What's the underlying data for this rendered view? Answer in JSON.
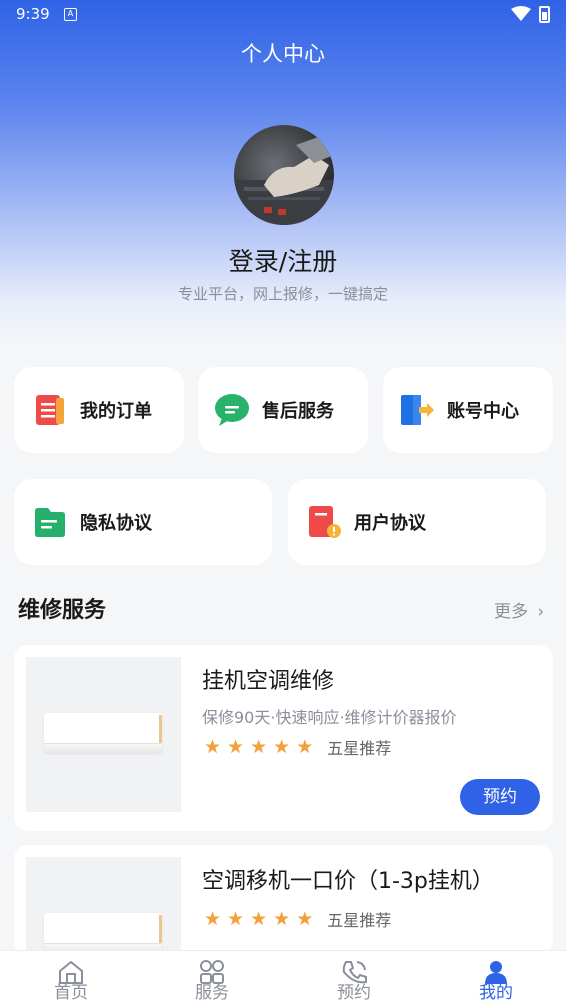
{
  "status_bar": {
    "time": "9:39",
    "notif_glyph": "A"
  },
  "header": {
    "title": "个人中心"
  },
  "profile": {
    "login_label": "登录/注册",
    "slogan": "专业平台，网上报修，一键搞定"
  },
  "quick_actions": [
    {
      "label": "我的订单",
      "icon": "order-list-icon"
    },
    {
      "label": "售后服务",
      "icon": "chat-bubble-icon"
    },
    {
      "label": "账号中心",
      "icon": "account-exit-icon"
    },
    {
      "label": "隐私协议",
      "icon": "privacy-folder-icon"
    },
    {
      "label": "用户协议",
      "icon": "user-agreement-icon"
    }
  ],
  "repair_section": {
    "title": "维修服务",
    "more_label": "更多"
  },
  "services": [
    {
      "name": "挂机空调维修",
      "desc": "保修90天·快速响应·维修计价器报价",
      "stars": 5,
      "rating_label": "五星推荐",
      "book_label": "预约"
    },
    {
      "name": "空调移机一口价（1-3p挂机）",
      "desc": "",
      "stars": 5,
      "rating_label": "五星推荐"
    }
  ],
  "tabbar": {
    "items": [
      {
        "label": "首页",
        "icon": "home-icon"
      },
      {
        "label": "服务",
        "icon": "grid-icon"
      },
      {
        "label": "预约",
        "icon": "phone-icon"
      },
      {
        "label": "我的",
        "icon": "user-icon"
      }
    ],
    "active_index": 3
  },
  "colors": {
    "accent": "#2f62e6",
    "star": "#f2a13a",
    "muted_text": "#8a8f99"
  }
}
